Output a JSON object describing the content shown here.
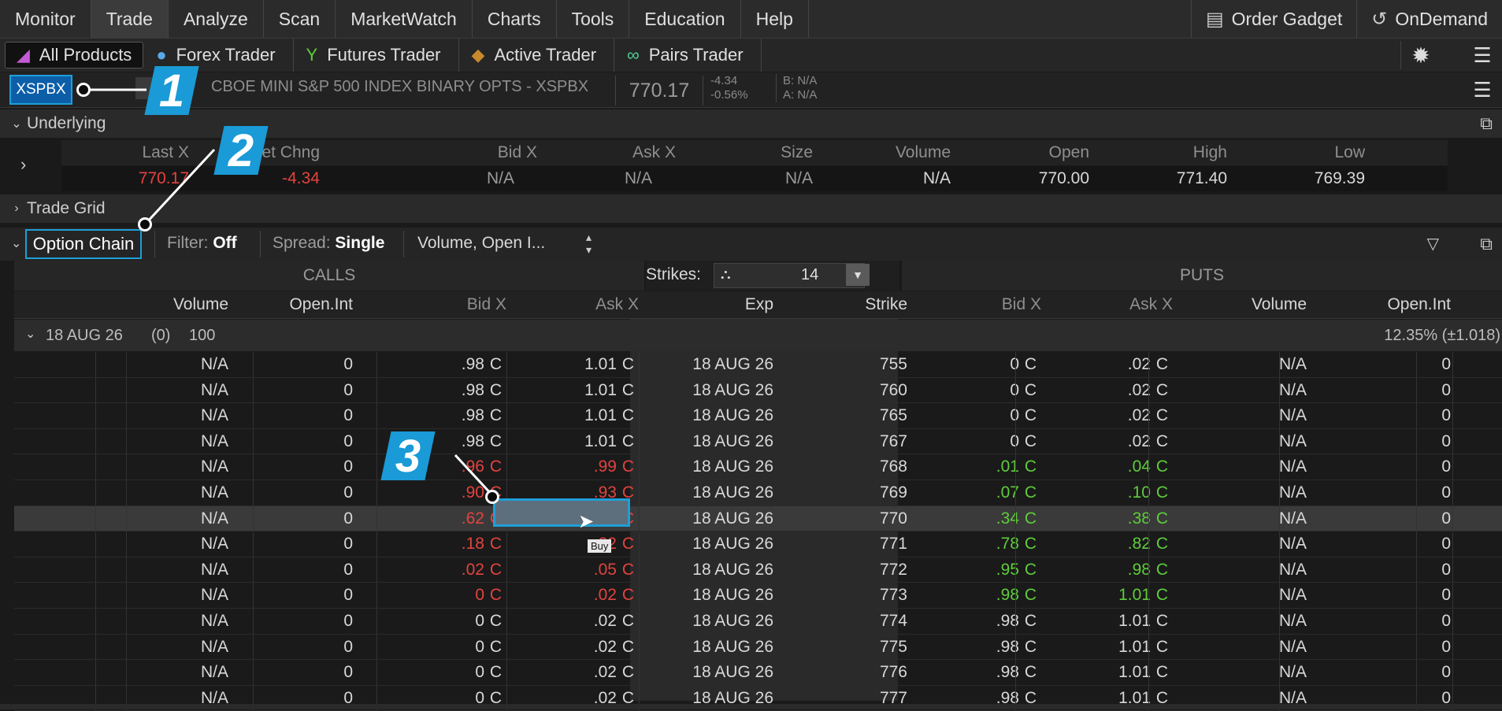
{
  "menu": {
    "items": [
      "Monitor",
      "Trade",
      "Analyze",
      "Scan",
      "MarketWatch",
      "Charts",
      "Tools",
      "Education",
      "Help"
    ],
    "active": "Trade",
    "order_gadget": "Order Gadget",
    "on_demand": "OnDemand"
  },
  "traders": [
    "All Products",
    "Forex Trader",
    "Futures Trader",
    "Active Trader",
    "Pairs Trader"
  ],
  "symbol": {
    "ticker": "XSPBX",
    "description": "CBOE MINI S&P 500 INDEX BINARY OPTS - XSPBX",
    "last": "770.17",
    "net_change": "-4.34",
    "pct_change": "-0.56%",
    "bid": "B: N/A",
    "ask": "A: N/A"
  },
  "underlying": {
    "title": "Underlying",
    "headers": [
      "Last X",
      "Net Chng",
      "Bid X",
      "Ask X",
      "Size",
      "Volume",
      "Open",
      "High",
      "Low"
    ],
    "values": [
      "770.17",
      "-4.34",
      "N/A",
      "N/A",
      "N/A",
      "N/A",
      "770.00",
      "771.40",
      "769.39"
    ]
  },
  "trade_grid": {
    "title": "Trade Grid"
  },
  "option_chain": {
    "title": "Option Chain",
    "filter_label": "Filter:",
    "filter_value": "Off",
    "spread_label": "Spread:",
    "spread_value": "Single",
    "columns_label": "Volume, Open I...",
    "calls_label": "CALLS",
    "puts_label": "PUTS",
    "strikes_label": "Strikes:",
    "strikes_value": "14",
    "headers": {
      "call_volume": "Volume",
      "call_oi": "Open.Int",
      "call_bid": "Bid X",
      "call_ask": "Ask X",
      "exp": "Exp",
      "strike": "Strike",
      "put_bid": "Bid X",
      "put_ask": "Ask X",
      "put_volume": "Volume",
      "put_oi": "Open.Int"
    },
    "group": {
      "label": "18 AUG 26",
      "count": "(0)",
      "multiplier": "100",
      "iv": "12.35% (±1.018)"
    },
    "rows": [
      {
        "cv": "N/A",
        "coi": "0",
        "cb": ".98",
        "ca": "1.01",
        "exp": "18 AUG 26",
        "strike": "755",
        "pb": "0",
        "pa": ".02",
        "pv": "N/A",
        "poi": "0",
        "cc": "gray",
        "pc": "gray"
      },
      {
        "cv": "N/A",
        "coi": "0",
        "cb": ".98",
        "ca": "1.01",
        "exp": "18 AUG 26",
        "strike": "760",
        "pb": "0",
        "pa": ".02",
        "pv": "N/A",
        "poi": "0",
        "cc": "gray",
        "pc": "gray"
      },
      {
        "cv": "N/A",
        "coi": "0",
        "cb": ".98",
        "ca": "1.01",
        "exp": "18 AUG 26",
        "strike": "765",
        "pb": "0",
        "pa": ".02",
        "pv": "N/A",
        "poi": "0",
        "cc": "gray",
        "pc": "gray"
      },
      {
        "cv": "N/A",
        "coi": "0",
        "cb": ".98",
        "ca": "1.01",
        "exp": "18 AUG 26",
        "strike": "767",
        "pb": "0",
        "pa": ".02",
        "pv": "N/A",
        "poi": "0",
        "cc": "gray",
        "pc": "gray"
      },
      {
        "cv": "N/A",
        "coi": "0",
        "cb": ".96",
        "ca": ".99",
        "exp": "18 AUG 26",
        "strike": "768",
        "pb": ".01",
        "pa": ".04",
        "pv": "N/A",
        "poi": "0",
        "cc": "red",
        "pc": "green"
      },
      {
        "cv": "N/A",
        "coi": "0",
        "cb": ".90",
        "ca": ".93",
        "exp": "18 AUG 26",
        "strike": "769",
        "pb": ".07",
        "pa": ".10",
        "pv": "N/A",
        "poi": "0",
        "cc": "red",
        "pc": "green"
      },
      {
        "cv": "N/A",
        "coi": "0",
        "cb": ".62",
        "ca": ".66",
        "exp": "18 AUG 26",
        "strike": "770",
        "pb": ".34",
        "pa": ".38",
        "pv": "N/A",
        "poi": "0",
        "cc": "red",
        "pc": "green",
        "sel": true
      },
      {
        "cv": "N/A",
        "coi": "0",
        "cb": ".18",
        "ca": ".22",
        "exp": "18 AUG 26",
        "strike": "771",
        "pb": ".78",
        "pa": ".82",
        "pv": "N/A",
        "poi": "0",
        "cc": "red",
        "pc": "green"
      },
      {
        "cv": "N/A",
        "coi": "0",
        "cb": ".02",
        "ca": ".05",
        "exp": "18 AUG 26",
        "strike": "772",
        "pb": ".95",
        "pa": ".98",
        "pv": "N/A",
        "poi": "0",
        "cc": "red",
        "pc": "green"
      },
      {
        "cv": "N/A",
        "coi": "0",
        "cb": "0",
        "ca": ".02",
        "exp": "18 AUG 26",
        "strike": "773",
        "pb": ".98",
        "pa": "1.01",
        "pv": "N/A",
        "poi": "0",
        "cc": "red",
        "pc": "green"
      },
      {
        "cv": "N/A",
        "coi": "0",
        "cb": "0",
        "ca": ".02",
        "exp": "18 AUG 26",
        "strike": "774",
        "pb": ".98",
        "pa": "1.01",
        "pv": "N/A",
        "poi": "0",
        "cc": "gray",
        "pc": "gray"
      },
      {
        "cv": "N/A",
        "coi": "0",
        "cb": "0",
        "ca": ".02",
        "exp": "18 AUG 26",
        "strike": "775",
        "pb": ".98",
        "pa": "1.01",
        "pv": "N/A",
        "poi": "0",
        "cc": "gray",
        "pc": "gray"
      },
      {
        "cv": "N/A",
        "coi": "0",
        "cb": "0",
        "ca": ".02",
        "exp": "18 AUG 26",
        "strike": "776",
        "pb": ".98",
        "pa": "1.01",
        "pv": "N/A",
        "poi": "0",
        "cc": "gray",
        "pc": "gray"
      },
      {
        "cv": "N/A",
        "coi": "0",
        "cb": "0",
        "ca": ".02",
        "exp": "18 AUG 26",
        "strike": "777",
        "pb": ".98",
        "pa": "1.01",
        "pv": "N/A",
        "poi": "0",
        "cc": "gray",
        "pc": "gray"
      }
    ],
    "exchange_code": "C",
    "buy_tooltip": "Buy"
  },
  "callouts": [
    "1",
    "2",
    "3"
  ],
  "colors": {
    "accent": "#1e9fd8",
    "up": "#5fcc3c",
    "down": "#e2433f"
  }
}
